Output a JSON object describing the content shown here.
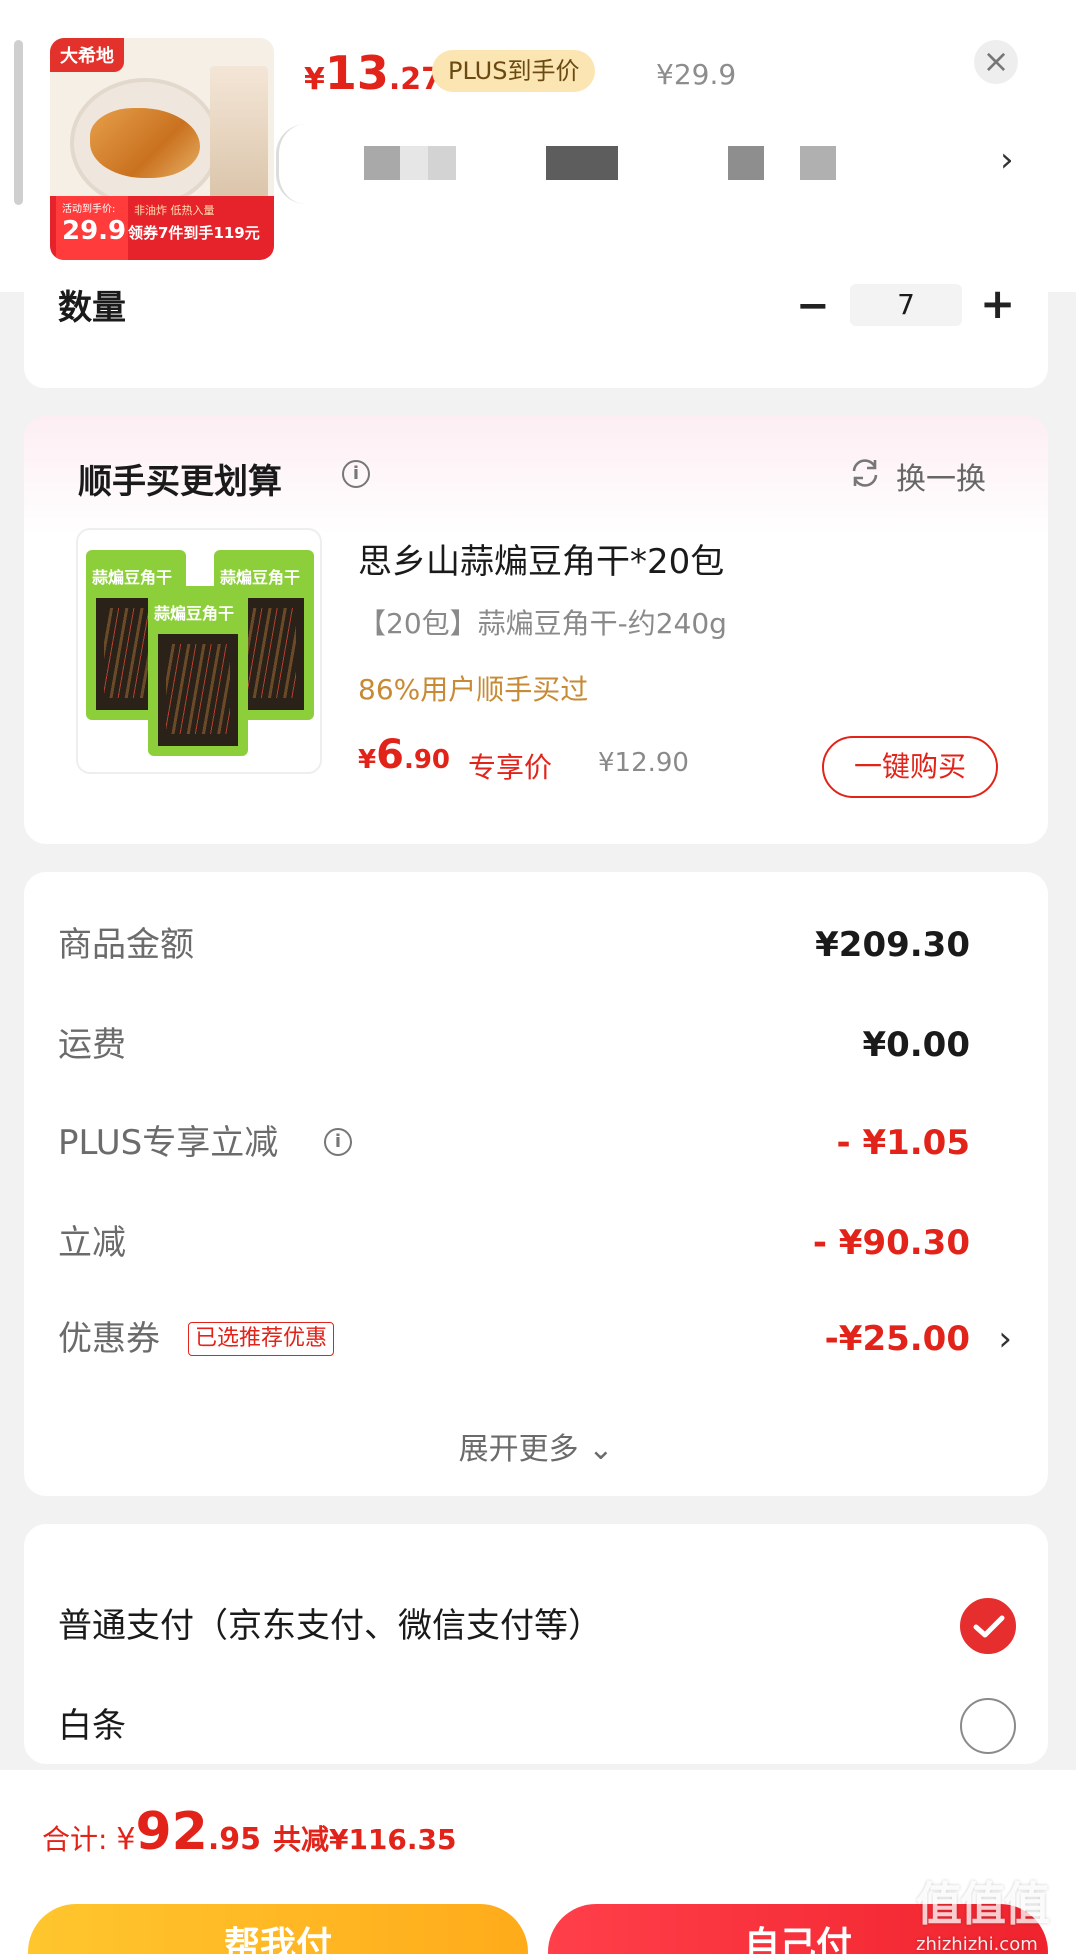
{
  "header": {
    "thumb": {
      "brand": "大希地",
      "deal_label": "活动到手价:",
      "deal_price": "29.9",
      "tagline": "非油炸 低热入量",
      "coupon_line": "领券7件到手119元"
    },
    "price_currency": "¥",
    "price_int": "13",
    "price_dec": ".27",
    "plus_badge": "PLUS到手价",
    "original_price": "¥29.9",
    "close_icon": "close-icon",
    "chevron_icon": "chevron-right-icon"
  },
  "quantity": {
    "label": "数量",
    "value": "7",
    "minus": "−",
    "plus": "+"
  },
  "recommendation": {
    "title": "顺手买更划算",
    "swap_label": "换一换",
    "product_name": "思乡山蒜煸豆角干*20包",
    "spec": "【20包】蒜煸豆角干-约240g",
    "bought": "86%用户顺手买过",
    "price_currency": "¥",
    "price_int": "6",
    "price_dec": ".90",
    "exclusive": "专享价",
    "original_price": "¥12.90",
    "buy_button": "一键购买",
    "bag_label": "蒜煸豆角干"
  },
  "amounts": {
    "rows": [
      {
        "label": "商品金额",
        "value": "¥209.30"
      },
      {
        "label": "运费",
        "value": "¥0.00"
      },
      {
        "label": "PLUS专享立减",
        "value": "- ¥1.05"
      },
      {
        "label": "立减",
        "value": "- ¥90.30"
      },
      {
        "label": "优惠券",
        "value": "-¥25.00",
        "badge": "已选推荐优惠"
      }
    ],
    "expand_more": "展开更多 ⌄"
  },
  "payment": {
    "options": [
      {
        "label": "普通支付（京东支付、微信支付等）",
        "selected": true
      },
      {
        "label": "白条",
        "selected": false
      }
    ]
  },
  "footer": {
    "total_label": "合计: ",
    "total_currency": "¥",
    "total_int": "92",
    "total_dec": ".95",
    "saved": "共减¥116.35",
    "help_pay": "帮我付",
    "self_pay": "自己付"
  },
  "watermark": {
    "logo": "值值值",
    "url": "zhizhizhi.com"
  },
  "colors": {
    "accent_red": "#e2231a",
    "plus_gold": "#fbe5b2",
    "help_button": "#ffb51f",
    "self_button": "#f0232d"
  }
}
